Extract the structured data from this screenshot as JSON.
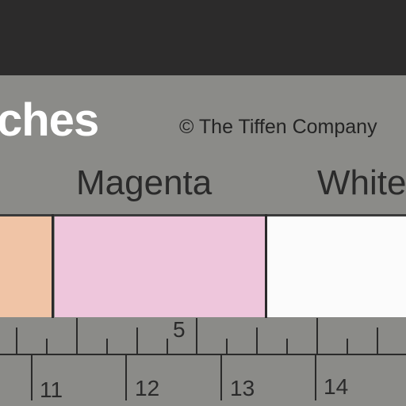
{
  "card": {
    "title": "ches",
    "copyright": "© The Tiffen Company",
    "labels": [
      "Magenta",
      "White"
    ]
  },
  "swatches": [
    {
      "color": "#f0c4a6"
    },
    {
      "color": "#eec6dc"
    },
    {
      "color": "#fbfbfb"
    }
  ],
  "ruler": {
    "inch_label": "5",
    "cm_labels": [
      "11",
      "12",
      "13",
      "14"
    ]
  },
  "colors": {
    "card": "#8b8b88",
    "background": "#2c2b2b"
  }
}
